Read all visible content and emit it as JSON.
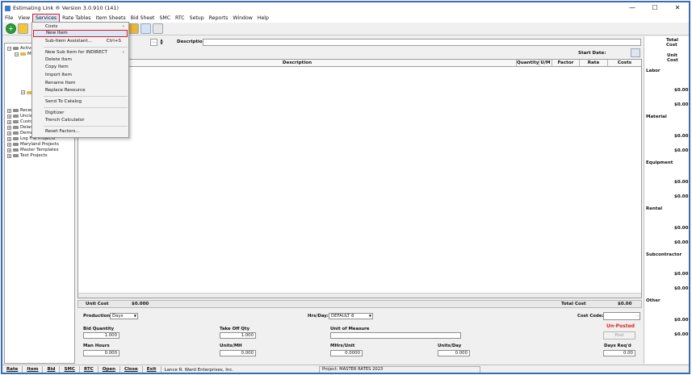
{
  "window": {
    "title": "Estimating Link ® Version  3.0.910 (141)",
    "controls": [
      "—",
      "☐",
      "✕"
    ]
  },
  "menubar": [
    "File",
    "View",
    "Services",
    "Rate Tables",
    "Item Sheets",
    "Bid Sheet",
    "SMC",
    "RTC",
    "Setup",
    "Reports",
    "Window",
    "Help"
  ],
  "services_menu": {
    "costs": "Costs",
    "new_item": "New Item",
    "sub_item_assistant": "Sub-Item Assistant...",
    "sub_item_shortcut": "Ctrl+S",
    "new_sub_item_indirect": "New Sub Item for INDIRECT",
    "delete_item": "Delete Item",
    "copy_item": "Copy Item",
    "import_item": "Import Item",
    "rename_item": "Rename Item",
    "replace_resource": "Replace Resource",
    "send_to_catalog": "Send To Catalog",
    "digitizer": "Digitizer",
    "trench_calculator": "Trench Calculator",
    "reset_factors": "Reset Factors..."
  },
  "tree": {
    "nodes": [
      "Active",
      "M",
      "Recen",
      "Unclas",
      "Custor",
      "Delan",
      "Demo",
      "Log File Projects",
      "Maryland Projects",
      "Master Templates",
      "Test Projects"
    ]
  },
  "item_header": {
    "description_label": "Description:",
    "start_date_label": "Start Date:"
  },
  "grid": {
    "columns": [
      "Description",
      "Quantity",
      "U/M",
      "Factor",
      "Rate",
      "Costs"
    ]
  },
  "unit_bar": {
    "unit_cost_label": "Unit Cost",
    "unit_cost_value": "$0.000",
    "total_cost_label": "Total Cost",
    "total_cost_value": "$0.00"
  },
  "lower": {
    "production_label": "Production:",
    "production_value": "Days",
    "hrs_day_label": "Hrs/Day:",
    "hrs_day_value": "DEFAULT 8",
    "cost_code_label": "Cost Code:",
    "bid_quantity_label": "Bid Quantity",
    "bid_quantity_value": "1.000",
    "take_off_qty_label": "Take Off Qty",
    "take_off_qty_value": "1.000",
    "unit_of_measure_label": "Unit of Measure",
    "man_hours_label": "Man Hours",
    "man_hours_value": "0.000",
    "units_mh_label": "Units/MH",
    "units_mh_value": "0.000",
    "mhrs_unit_label": "MHrs/Unit",
    "mhrs_unit_value": "0.0000",
    "units_day_label": "Units/Day",
    "units_day_value": "0.000",
    "days_reqd_label": "Days Req'd",
    "days_reqd_value": "0.00",
    "status": "Un-Posted",
    "post_button": "Post"
  },
  "right_panel": {
    "total_cost": "Total Cost",
    "unit_cost": "Unit Cost",
    "sections": [
      {
        "label": "Labor",
        "total": "$0.00",
        "unit": "$0.00"
      },
      {
        "label": "Material",
        "total": "$0.00",
        "unit": "$0.00"
      },
      {
        "label": "Equipment",
        "total": "$0.00",
        "unit": "$0.00"
      },
      {
        "label": "Rental",
        "total": "$0.00",
        "unit": "$0.00"
      },
      {
        "label": "Subcontractor",
        "total": "$0.00",
        "unit": "$0.00"
      },
      {
        "label": "Other",
        "total": "$0.00",
        "unit": "$0.00"
      }
    ]
  },
  "statusbar": {
    "buttons": [
      "Rate",
      "Item",
      "Bid",
      "SMC",
      "RTC",
      "Open",
      "Close",
      "Exit"
    ],
    "company": "Lance R. Ward Enterprises, Inc.",
    "project": "Project: MASTER RATES 2023"
  },
  "colors": {
    "highlight": "#d0202a",
    "window_border": "#3b6db3",
    "unposted": "#e0241b"
  }
}
